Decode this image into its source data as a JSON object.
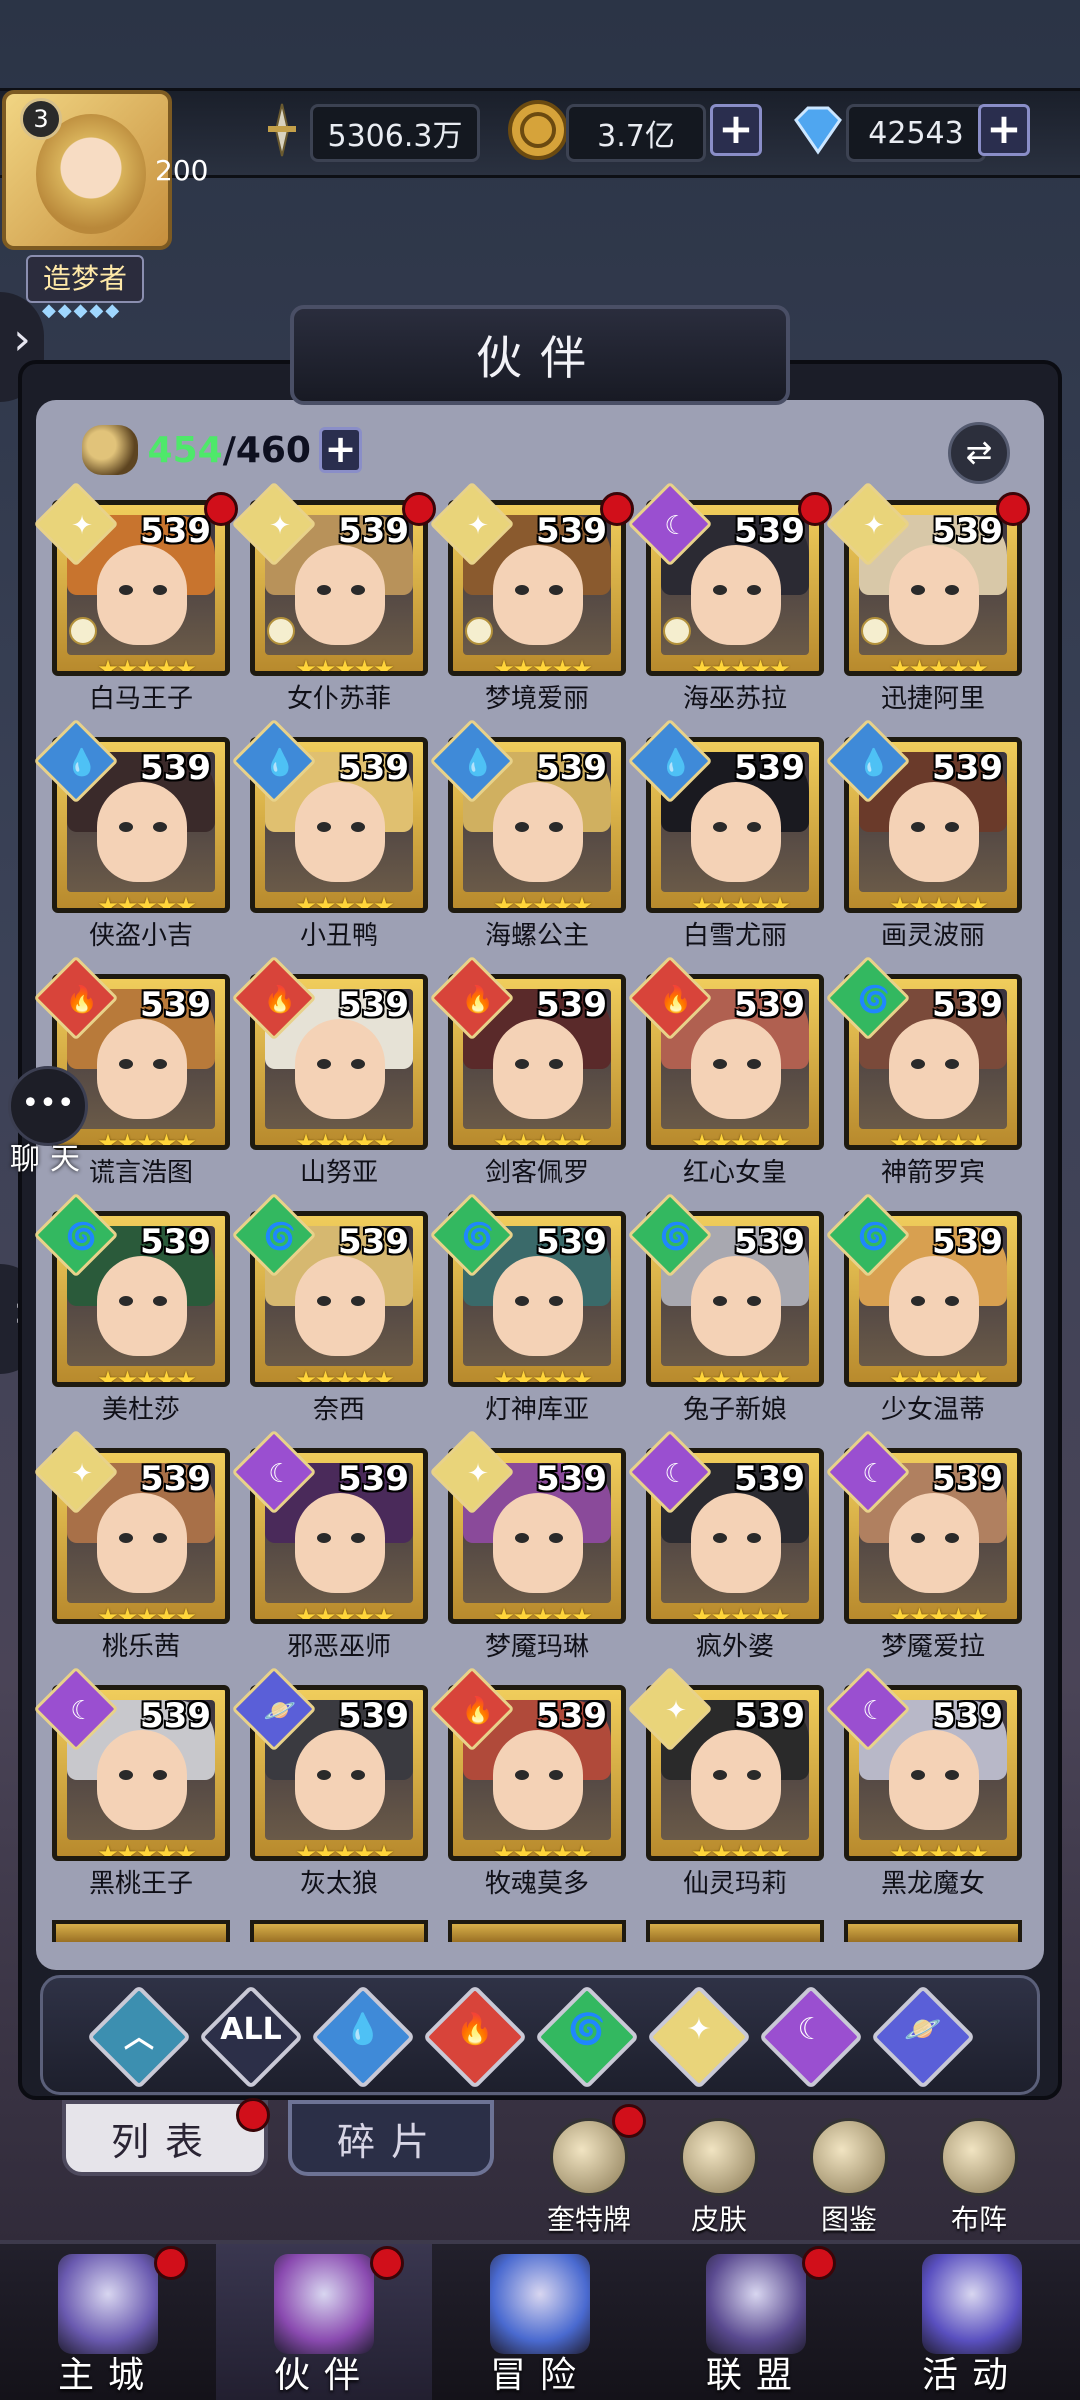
{
  "player": {
    "level": "3",
    "vip_value": "200",
    "title": "造梦者"
  },
  "resources": {
    "power": "5306.3万",
    "gold": "3.7亿",
    "diamond": "42543"
  },
  "panel": {
    "title": "伙伴",
    "count_current": "454",
    "count_max": "/460"
  },
  "heroes": [
    {
      "name": "白马王子",
      "level": "539",
      "element": "light",
      "red_dot": true
    },
    {
      "name": "女仆苏菲",
      "level": "539",
      "element": "light",
      "red_dot": true
    },
    {
      "name": "梦境爱丽",
      "level": "539",
      "element": "light",
      "red_dot": true
    },
    {
      "name": "海巫苏拉",
      "level": "539",
      "element": "dark",
      "red_dot": true
    },
    {
      "name": "迅捷阿里",
      "level": "539",
      "element": "light",
      "red_dot": true
    },
    {
      "name": "侠盗小吉",
      "level": "539",
      "element": "water",
      "red_dot": false
    },
    {
      "name": "小丑鸭",
      "level": "539",
      "element": "water",
      "red_dot": false
    },
    {
      "name": "海螺公主",
      "level": "539",
      "element": "water",
      "red_dot": false
    },
    {
      "name": "白雪尤丽",
      "level": "539",
      "element": "water",
      "red_dot": false
    },
    {
      "name": "画灵波丽",
      "level": "539",
      "element": "water",
      "red_dot": false
    },
    {
      "name": "谎言浩图",
      "level": "539",
      "element": "fire",
      "red_dot": false
    },
    {
      "name": "山努亚",
      "level": "539",
      "element": "fire",
      "red_dot": false
    },
    {
      "name": "剑客佩罗",
      "level": "539",
      "element": "fire",
      "red_dot": false
    },
    {
      "name": "红心女皇",
      "level": "539",
      "element": "fire",
      "red_dot": false
    },
    {
      "name": "神箭罗宾",
      "level": "539",
      "element": "wind",
      "red_dot": false
    },
    {
      "name": "美杜莎",
      "level": "539",
      "element": "wind",
      "red_dot": false
    },
    {
      "name": "奈西",
      "level": "539",
      "element": "wind",
      "red_dot": false
    },
    {
      "name": "灯神库亚",
      "level": "539",
      "element": "wind",
      "red_dot": false
    },
    {
      "name": "兔子新娘",
      "level": "539",
      "element": "wind",
      "red_dot": false
    },
    {
      "name": "少女温蒂",
      "level": "539",
      "element": "wind",
      "red_dot": false
    },
    {
      "name": "桃乐茜",
      "level": "539",
      "element": "light",
      "red_dot": false
    },
    {
      "name": "邪恶巫师",
      "level": "539",
      "element": "dark",
      "red_dot": false
    },
    {
      "name": "梦魇玛琳",
      "level": "539",
      "element": "light",
      "red_dot": false
    },
    {
      "name": "疯外婆",
      "level": "539",
      "element": "dark",
      "red_dot": false
    },
    {
      "name": "梦魇爱拉",
      "level": "539",
      "element": "dark",
      "red_dot": false
    },
    {
      "name": "黑桃王子",
      "level": "539",
      "element": "dark",
      "red_dot": false
    },
    {
      "name": "灰太狼",
      "level": "539",
      "element": "cosmic",
      "red_dot": false
    },
    {
      "name": "牧魂莫多",
      "level": "539",
      "element": "fire",
      "red_dot": false
    },
    {
      "name": "仙灵玛莉",
      "level": "539",
      "element": "light",
      "red_dot": false
    },
    {
      "name": "黑龙魔女",
      "level": "539",
      "element": "dark",
      "red_dot": false
    }
  ],
  "filters": [
    {
      "id": "faction",
      "label": ""
    },
    {
      "id": "all",
      "label": "ALL"
    },
    {
      "id": "water",
      "label": ""
    },
    {
      "id": "fire",
      "label": ""
    },
    {
      "id": "wind",
      "label": ""
    },
    {
      "id": "light",
      "label": ""
    },
    {
      "id": "dark",
      "label": ""
    },
    {
      "id": "cosmic",
      "label": ""
    }
  ],
  "tabs": {
    "list": "列表",
    "fragments": "碎片"
  },
  "quick_actions": [
    {
      "label": "奎特牌",
      "red_dot": true
    },
    {
      "label": "皮肤",
      "red_dot": false
    },
    {
      "label": "图鉴",
      "red_dot": false
    },
    {
      "label": "布阵",
      "red_dot": false
    }
  ],
  "chat": {
    "label": "聊天"
  },
  "nav": [
    {
      "label": "主城",
      "red_dot": true
    },
    {
      "label": "伙伴",
      "red_dot": true
    },
    {
      "label": "冒险",
      "red_dot": false
    },
    {
      "label": "联盟",
      "red_dot": true
    },
    {
      "label": "活动",
      "red_dot": false
    }
  ],
  "colors": {
    "light": "#e9d47a",
    "water": "#3f8ad8",
    "fire": "#d8443a",
    "wind": "#33b860",
    "dark": "#9a4fd0",
    "cosmic": "#5a5fd8",
    "faction": "#3c8fb0"
  }
}
